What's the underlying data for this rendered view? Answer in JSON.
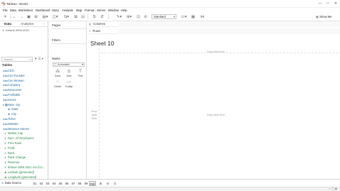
{
  "window": {
    "title": "Tableau - Book1",
    "controls": [
      "—",
      "□",
      "✕"
    ]
  },
  "menu": [
    "File",
    "Data",
    "Worksheet",
    "Dashboard",
    "Story",
    "Analysis",
    "Map",
    "Format",
    "Server",
    "Window",
    "Help"
  ],
  "toolbar": {
    "view_size": "Standard",
    "show_me": "Show Me"
  },
  "data_pane": {
    "tabs": [
      "Data",
      "Analytics"
    ],
    "data_source": "fortune 2000-2021",
    "search_placeholder": "Search",
    "tables_header": "Tables",
    "fields": [
      {
        "label": "CEO",
        "kind": "dim",
        "icon": "Abc"
      },
      {
        "label": "Ceo Founder",
        "kind": "dim",
        "icon": "Abc"
      },
      {
        "label": "Ceo Woman",
        "kind": "dim",
        "icon": "Abc"
      },
      {
        "label": "Company",
        "kind": "dim",
        "icon": "Abc"
      },
      {
        "label": "Newcomer",
        "kind": "dim",
        "icon": "Abc"
      },
      {
        "label": "Profitable",
        "kind": "dim",
        "icon": "Abc"
      },
      {
        "label": "Sector",
        "kind": "dim",
        "icon": "Abc"
      },
      {
        "label": "state, city",
        "kind": "dim",
        "icon": "▾ ⛓"
      },
      {
        "label": "State",
        "kind": "dim",
        "icon": "⊕",
        "indent": true
      },
      {
        "label": "City",
        "kind": "dim",
        "icon": "⊕",
        "indent": true
      },
      {
        "label": "Ticker",
        "kind": "dim",
        "icon": "Abc"
      },
      {
        "label": "Website",
        "kind": "dim",
        "icon": "Abc"
      },
      {
        "label": "Measure Names",
        "kind": "dim",
        "icon": "Abc",
        "italic": true
      },
      {
        "label": "Market Cap",
        "kind": "meas",
        "icon": "#"
      },
      {
        "label": "Num. Of Employees",
        "kind": "meas",
        "icon": "#"
      },
      {
        "label": "Prev Rank",
        "kind": "meas",
        "icon": "#"
      },
      {
        "label": "Profit",
        "kind": "meas",
        "icon": "#"
      },
      {
        "label": "Rank",
        "kind": "meas",
        "icon": "#"
      },
      {
        "label": "Rank Change",
        "kind": "meas",
        "icon": "#"
      },
      {
        "label": "Revenue",
        "kind": "meas",
        "icon": "#"
      },
      {
        "label": "fortune 2000-2021 csv (Co...",
        "kind": "meas",
        "icon": "#",
        "italic": true
      },
      {
        "label": "Latitude (generated)",
        "kind": "meas",
        "icon": "⊕",
        "italic": true
      },
      {
        "label": "Longitude (generated)",
        "kind": "meas",
        "icon": "⊕",
        "italic": true
      },
      {
        "label": "Measure Values",
        "kind": "meas",
        "icon": "#",
        "italic": true
      }
    ]
  },
  "cards": {
    "pages": "Pages",
    "filters": "Filters",
    "marks": "Marks",
    "marks_type": "Automatic",
    "mark_buttons": [
      "Color",
      "Size",
      "Text",
      "Detail",
      "Tooltip"
    ]
  },
  "shelves": {
    "columns": "Columns",
    "rows": "Rows"
  },
  "sheet": {
    "title": "Sheet 10",
    "drop_field_top": "Drop field here",
    "drop_field_center": "Drop field here",
    "drop_field_left": "Drop field here"
  },
  "tabs": {
    "data_source": "Data Source",
    "sheets": [
      "01",
      "02",
      "03",
      "04",
      "05",
      "06",
      "07",
      "08",
      "09",
      "010"
    ],
    "active_index": 9
  }
}
